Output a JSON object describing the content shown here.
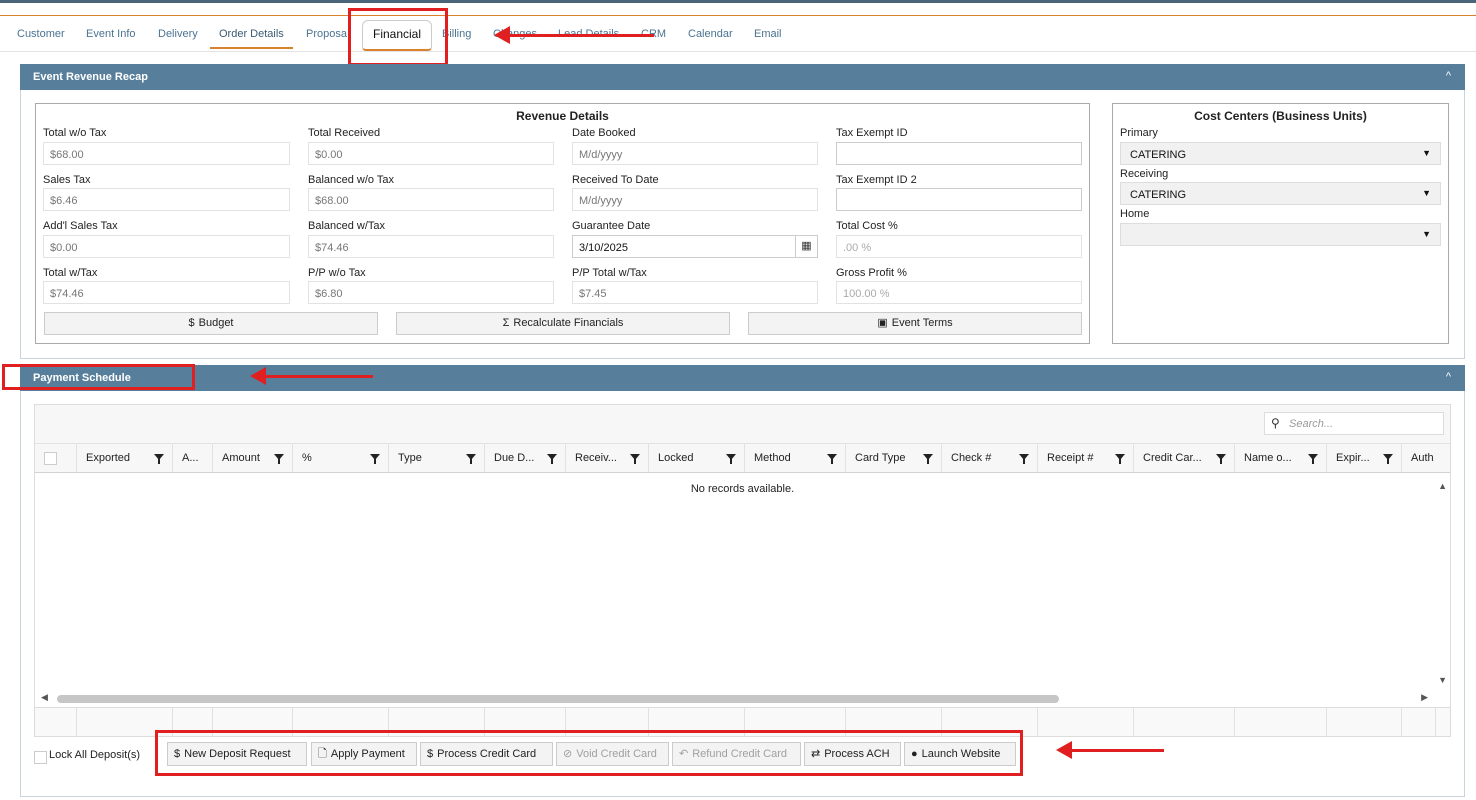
{
  "tabs": [
    {
      "label": "Customer"
    },
    {
      "label": "Event Info"
    },
    {
      "label": "Delivery"
    },
    {
      "label": "Order Details"
    },
    {
      "label": "Proposa"
    },
    {
      "label": "Financial"
    },
    {
      "label": "Billing"
    },
    {
      "label": "Changes"
    },
    {
      "label": "Lead Details"
    },
    {
      "label": "CRM"
    },
    {
      "label": "Calendar"
    },
    {
      "label": "Email"
    }
  ],
  "revenue_recap": {
    "title": "Event Revenue Recap",
    "caret": "^",
    "details_title": "Revenue Details",
    "fields": [
      {
        "label": "Total w/o Tax",
        "value": "$68.00"
      },
      {
        "label": "Total Received",
        "value": "$0.00"
      },
      {
        "label": "Date Booked",
        "value": "M/d/yyyy"
      },
      {
        "label": "Tax Exempt ID",
        "value": ""
      },
      {
        "label": "Sales Tax",
        "value": "$6.46"
      },
      {
        "label": "Balanced w/o Tax",
        "value": "$68.00"
      },
      {
        "label": "Received To Date",
        "value": "M/d/yyyy"
      },
      {
        "label": "Tax Exempt ID 2",
        "value": ""
      },
      {
        "label": "Add'l Sales Tax",
        "value": "$0.00"
      },
      {
        "label": "Balanced w/Tax",
        "value": "$74.46"
      },
      {
        "label": "Guarantee Date",
        "value": "3/10/2025"
      },
      {
        "label": "Total Cost %",
        "value": ".00 %"
      },
      {
        "label": "Total w/Tax",
        "value": "$74.46"
      },
      {
        "label": "P/P w/o Tax",
        "value": "$6.80"
      },
      {
        "label": "P/P Total w/Tax",
        "value": "$7.45"
      },
      {
        "label": "Gross Profit %",
        "value": "100.00 %"
      }
    ],
    "buttons": [
      {
        "icon": "$",
        "label": "Budget"
      },
      {
        "icon": "Σ",
        "label": "Recalculate Financials"
      },
      {
        "icon": "▣",
        "label": "Event Terms"
      }
    ],
    "cost_centers": {
      "title": "Cost Centers (Business Units)",
      "primary_label": "Primary",
      "primary_value": "CATERING",
      "receiving_label": "Receiving",
      "receiving_value": "CATERING",
      "home_label": "Home",
      "home_value": ""
    }
  },
  "payment_schedule": {
    "title": "Payment Schedule",
    "caret": "^",
    "search_placeholder": "Search...",
    "columns": [
      "Exported",
      "A...",
      "Amount",
      "%",
      "Type",
      "Due D...",
      "Receiv...",
      "Locked",
      "Method",
      "Card Type",
      "Check #",
      "Receipt #",
      "Credit Car...",
      "Name o...",
      "Expir...",
      "Auth"
    ],
    "empty_message": "No records available.",
    "lock_all_label": "Lock All Deposit(s)",
    "actions": [
      {
        "icon": "$",
        "label": "New Deposit Request",
        "enabled": true
      },
      {
        "icon": "🗋",
        "label": "Apply Payment",
        "enabled": true
      },
      {
        "icon": "$",
        "label": "Process Credit Card",
        "enabled": true
      },
      {
        "icon": "⊘",
        "label": "Void Credit Card",
        "enabled": false
      },
      {
        "icon": "↶",
        "label": "Refund Credit Card",
        "enabled": false
      },
      {
        "icon": "⇄",
        "label": "Process ACH",
        "enabled": true
      },
      {
        "icon": "●",
        "label": "Launch Website",
        "enabled": true
      }
    ]
  },
  "colors": {
    "panel_header": "#577f9c",
    "accent": "#d9822b",
    "annotation": "#e02020"
  }
}
